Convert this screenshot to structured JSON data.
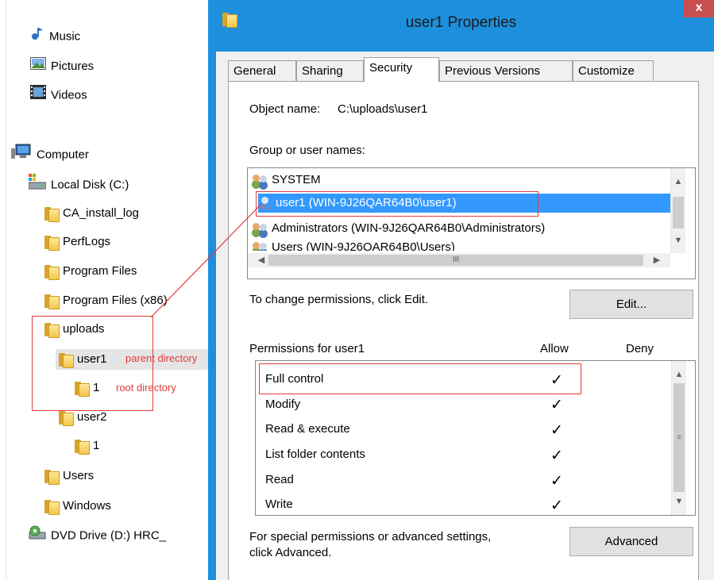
{
  "tree": {
    "items": [
      {
        "label": "Music",
        "icon": "music-icon"
      },
      {
        "label": "Pictures",
        "icon": "pictures-icon"
      },
      {
        "label": "Videos",
        "icon": "videos-icon"
      },
      {
        "label": "Computer",
        "icon": "computer-icon"
      },
      {
        "label": "Local Disk (C:)",
        "icon": "drive-icon"
      },
      {
        "label": "CA_install_log",
        "icon": "folder-icon"
      },
      {
        "label": "PerfLogs",
        "icon": "folder-icon"
      },
      {
        "label": "Program Files",
        "icon": "folder-icon"
      },
      {
        "label": "Program Files (x86)",
        "icon": "folder-icon"
      },
      {
        "label": "uploads",
        "icon": "folder-icon"
      },
      {
        "label": "user1",
        "icon": "folder-icon"
      },
      {
        "label": "1",
        "icon": "folder-icon"
      },
      {
        "label": "user2",
        "icon": "folder-icon"
      },
      {
        "label": "1",
        "icon": "folder-icon"
      },
      {
        "label": "Users",
        "icon": "folder-icon"
      },
      {
        "label": "Windows",
        "icon": "folder-icon"
      },
      {
        "label": "DVD Drive (D:) HRC_",
        "icon": "dvd-icon"
      }
    ]
  },
  "annotations": {
    "parent": "parent directory",
    "root": "root directory"
  },
  "dialog": {
    "title": "user1 Properties",
    "close": "x",
    "tabs": [
      "General",
      "Sharing",
      "Security",
      "Previous Versions",
      "Customize"
    ],
    "object_name_label": "Object name:",
    "object_name_value": "C:\\uploads\\user1",
    "group_label": "Group or user names:",
    "users": [
      "SYSTEM",
      "user1 (WIN-9J26QAR64B0\\user1)",
      "Administrators (WIN-9J26QAR64B0\\Administrators)",
      "Users (WIN-9J26QAR64B0\\Users)"
    ],
    "hscroll_grip": "III",
    "change_text": "To change permissions, click Edit.",
    "edit_button": "Edit...",
    "perm_header": "Permissions for user1",
    "allow_header": "Allow",
    "deny_header": "Deny",
    "permissions": [
      "Full control",
      "Modify",
      "Read & execute",
      "List folder contents",
      "Read",
      "Write"
    ],
    "check": "✓",
    "advanced_text_1": "For special permissions or advanced settings,",
    "advanced_text_2": "click Advanced.",
    "advanced_button": "Advanced"
  },
  "colors": {
    "titlebar": "#1e8fdc",
    "selection": "#3399ff",
    "annotation": "#e23a3a"
  }
}
